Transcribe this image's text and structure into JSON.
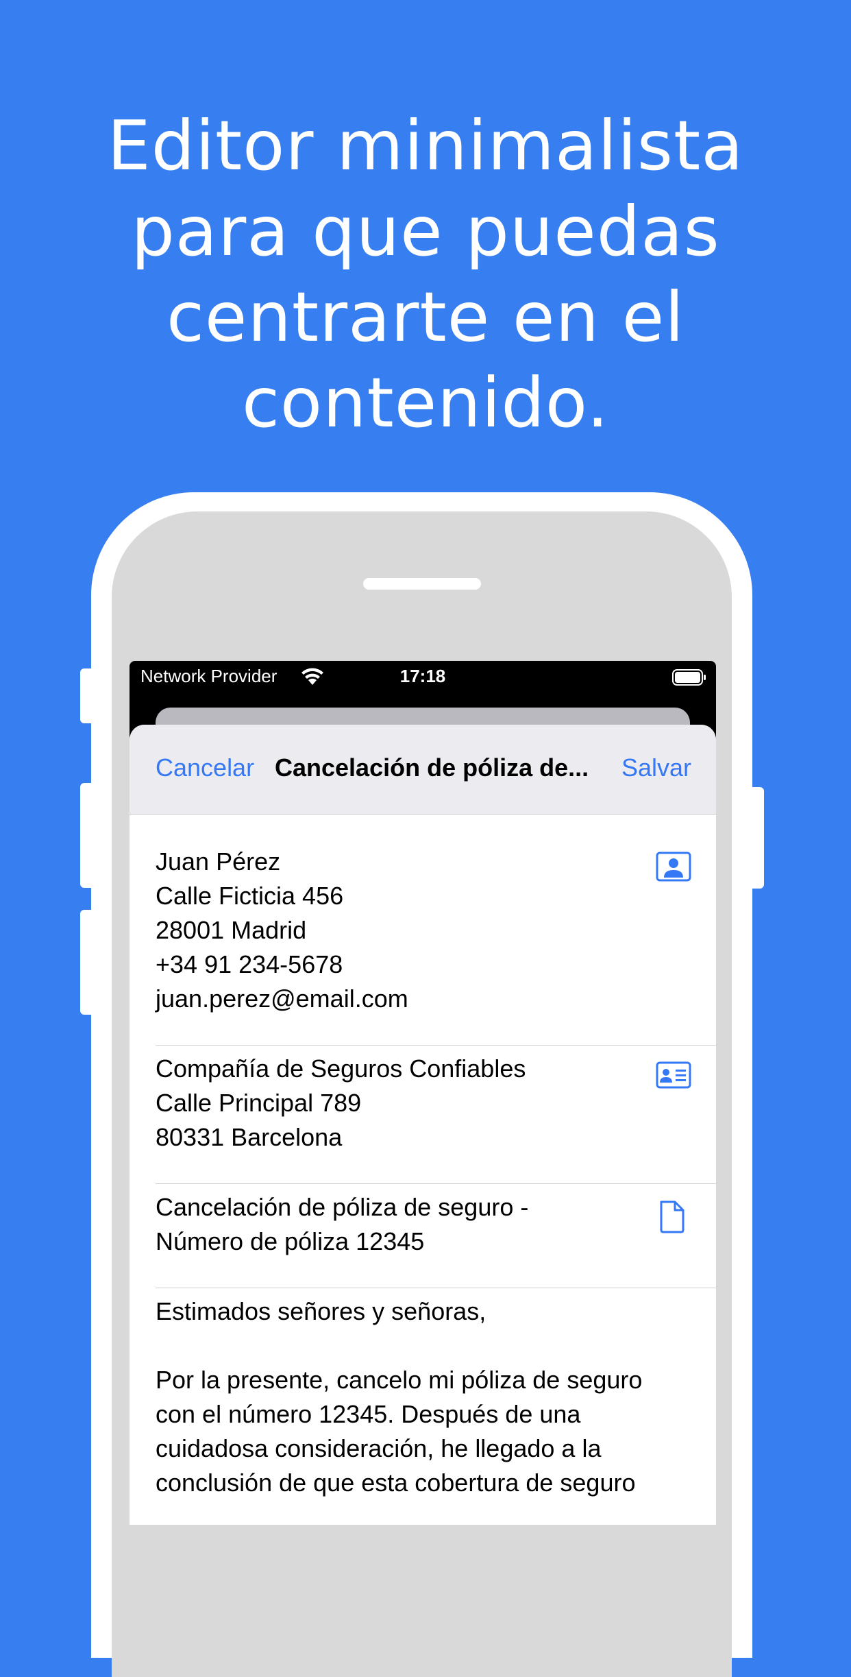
{
  "headline": [
    "Editor minimalista",
    "para que puedas",
    "centrarte en el",
    "contenido."
  ],
  "status_bar": {
    "carrier": "Network Provider",
    "time": "17:18",
    "wifi_icon": "wifi-icon",
    "battery_icon": "battery-icon"
  },
  "nav": {
    "cancel": "Cancelar",
    "title": "Cancelación de póliza de...",
    "save": "Salvar"
  },
  "sender": {
    "icon": "person-portrait-icon",
    "lines": [
      "Juan Pérez",
      "Calle Ficticia 456",
      "28001 Madrid",
      "+34 91 234-5678",
      "juan.perez@email.com"
    ]
  },
  "recipient": {
    "icon": "contact-card-icon",
    "lines": [
      "Compañía de Seguros Confiables",
      "Calle Principal 789",
      "80331 Barcelona"
    ]
  },
  "subject": {
    "icon": "document-icon",
    "lines": [
      "Cancelación de póliza de seguro -",
      "Número de póliza 12345"
    ]
  },
  "body": {
    "greeting": "Estimados señores y señoras,",
    "lines": [
      "Por la presente, cancelo mi póliza de seguro",
      "con el número 12345. Después de una",
      "cuidadosa consideración, he llegado a la",
      "conclusión de que esta cobertura de seguro"
    ]
  },
  "colors": {
    "background": "#377ff1",
    "accent": "#3478f6"
  }
}
